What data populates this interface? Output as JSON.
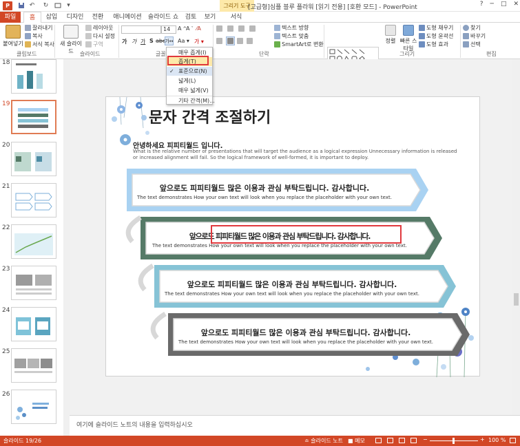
{
  "titlebar": {
    "app_icon": "P",
    "context_tab": "그리기 도구",
    "title": "[고급형]심플 블루 플라워 [읽기 전용] [호환 모드] - PowerPoint",
    "help": "?",
    "minimize": "─",
    "restore": "□",
    "close": "✕"
  },
  "tabs": [
    {
      "label": "파일"
    },
    {
      "label": "홈"
    },
    {
      "label": "삽입"
    },
    {
      "label": "디자인"
    },
    {
      "label": "전환"
    },
    {
      "label": "애니메이션"
    },
    {
      "label": "슬라이드 쇼"
    },
    {
      "label": "검토"
    },
    {
      "label": "보기"
    },
    {
      "label": "서식"
    }
  ],
  "ribbon": {
    "paste": "붙여넣기",
    "cut": "잘라내기",
    "copy": "복사",
    "format_painter": "서식 복사",
    "new_slide": "새 슬라이드",
    "layout": "레이아웃",
    "reset": "다시 설정",
    "section": "구역",
    "font_size": "14",
    "text_direction": "텍스트 방향",
    "align_text": "텍스트 맞춤",
    "smartart": "SmartArt로 변환",
    "arrange": "정렬",
    "quick_styles": "빠른 스타일",
    "shape_fill": "도형 채우기",
    "shape_outline": "도형 윤곽선",
    "shape_effects": "도형 효과",
    "find": "찾기",
    "replace": "바꾸기",
    "select": "선택",
    "groups": {
      "clipboard": "클립보드",
      "slides": "슬라이드",
      "font": "글꼴",
      "paragraph": "단락",
      "drawing": "그리기",
      "editing": "편집"
    }
  },
  "spacing_menu": {
    "items": [
      {
        "label": "매우 좁게(I)"
      },
      {
        "label": "좁게(T)"
      },
      {
        "label": "표준으로(N)"
      },
      {
        "label": "넓게(L)"
      },
      {
        "label": "매우 넓게(V)"
      },
      {
        "label": "기타 간격(M)..."
      }
    ],
    "checked_index": 2,
    "highlighted_index": 1
  },
  "thumbnails": [
    {
      "number": "18"
    },
    {
      "number": "19"
    },
    {
      "number": "20"
    },
    {
      "number": "21"
    },
    {
      "number": "22"
    },
    {
      "number": "23"
    },
    {
      "number": "24"
    },
    {
      "number": "25"
    },
    {
      "number": "26"
    }
  ],
  "slide": {
    "title": "문자 간격 조절하기",
    "heading": "안녕하세요 피피티월드 입니다.",
    "intro_line1": "What is the relative number of presentations that will target the audience as a logical expression Unnecessary information is released",
    "intro_line2": "or increased alignment will fail. So the logical framework of well-formed, it is important to deploy.",
    "bands": [
      {
        "korean": "앞으로도 피피티월드 많은 이용과 관심 부탁드립니다. 감사합니다.",
        "english": "The text demonstrates How your own text will look when you replace the placeholder with your own text.",
        "color": "#a9d2f2"
      },
      {
        "korean": "앞으로도 피피티월드 많은 이용과 관심 부탁드립니다. 감사합니다.",
        "english": "The text demonstrates How your own text will look when you replace the placeholder with your own text.",
        "color": "#557a67"
      },
      {
        "korean": "앞으로도 피피티월드 많은 이용과 관심 부탁드립니다. 감사합니다.",
        "english": "The text demonstrates How your own text will look when you replace the placeholder with your own text.",
        "color": "#86c3d6"
      },
      {
        "korean": "앞으로도 피피티월드 많은 이용과 관심 부탁드립니다. 감사합니다.",
        "english": "The text demonstrates How your own text will look when you replace the placeholder with your own text.",
        "color": "#6a6a6a"
      }
    ]
  },
  "notes": {
    "placeholder": "여기에 슬라이드 노트의 내용을 입력하십시오"
  },
  "status": {
    "slide_info": "슬라이드 19/26",
    "notes_btn": "슬라이드 노트",
    "comments_btn": "메모",
    "zoom": "100 %"
  },
  "colors": {
    "accent": "#d24726",
    "highlight": "#e0383c"
  }
}
